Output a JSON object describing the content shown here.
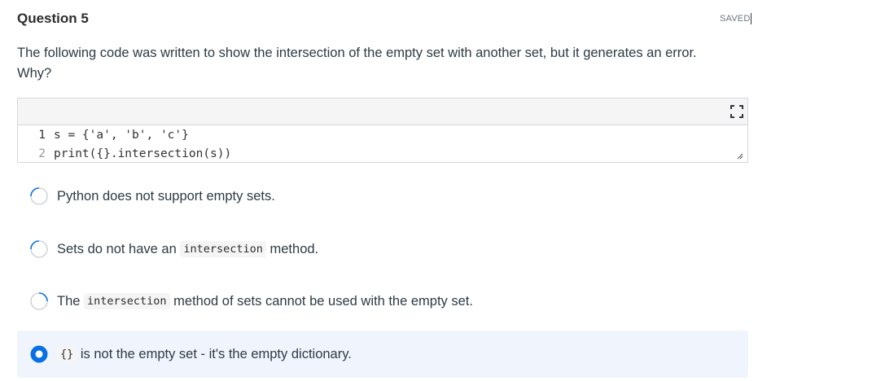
{
  "question": {
    "title": "Question 5",
    "status": "SAVED",
    "text": "The following code was written to show the intersection of the empty set with another set, but it generates an error. Why?"
  },
  "code": {
    "lines": [
      {
        "num": "1",
        "text": "s = {'a', 'b', 'c'}"
      },
      {
        "num": "2",
        "text": "print({}.intersection(s))"
      }
    ],
    "expand_icon": "expand-icon",
    "resize_icon": "resize-handle-icon"
  },
  "options": [
    {
      "before": "Python does not support empty sets.",
      "code": "",
      "after": "",
      "selected": false
    },
    {
      "before": "Sets do not have an ",
      "code": "intersection",
      "after": " method.",
      "selected": false
    },
    {
      "before": "The ",
      "code": "intersection",
      "after": " method of sets cannot be used with the empty set.",
      "selected": false
    },
    {
      "before": "",
      "code": "{}",
      "after": " is not the empty set - it's the empty dictionary.",
      "selected": true
    }
  ],
  "colors": {
    "accent": "#0770e3",
    "radio_border": "#c7cdd1",
    "selected_bg": "#f0f4fc"
  }
}
